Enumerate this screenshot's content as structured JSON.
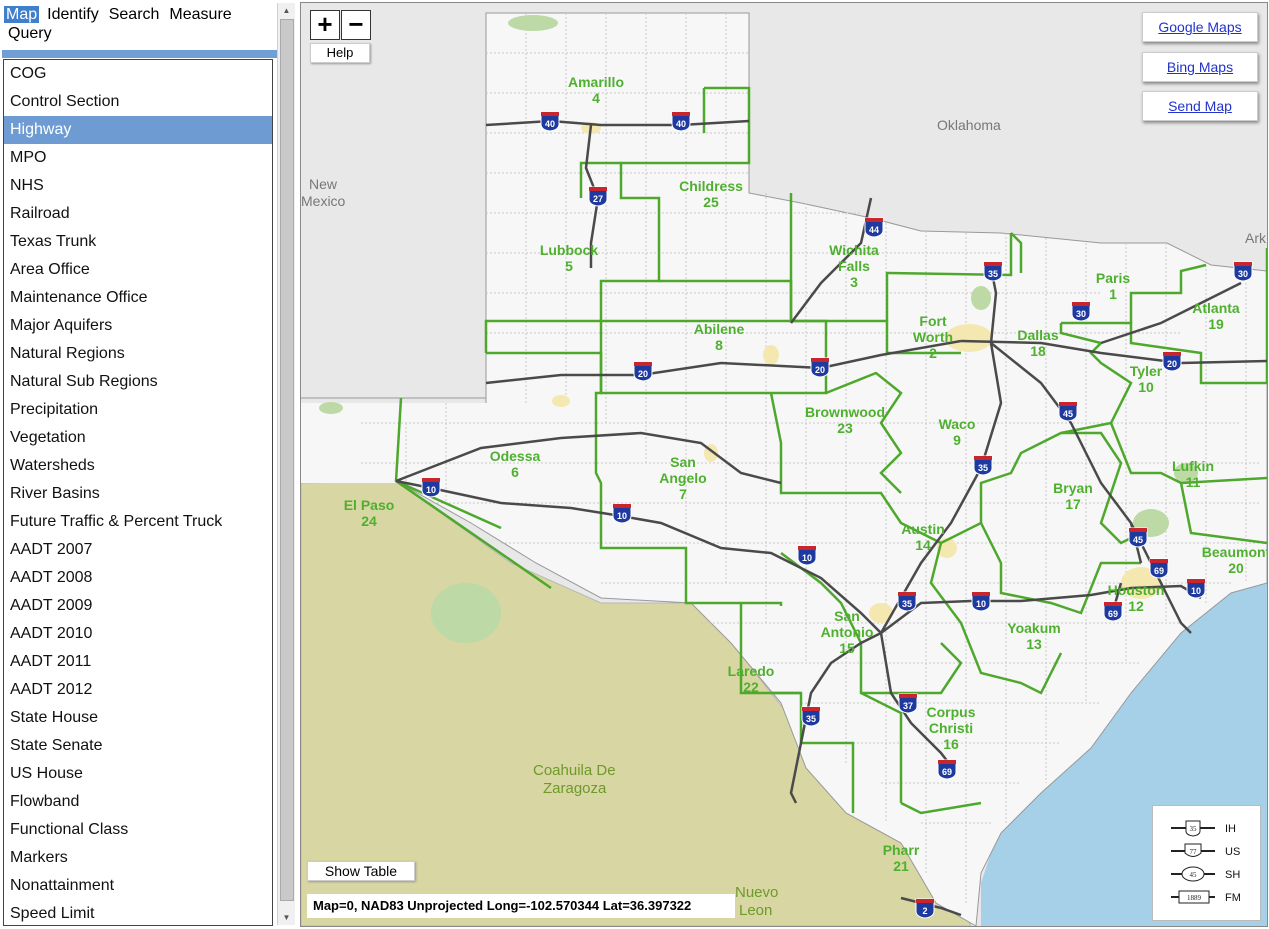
{
  "nav": {
    "tabs": [
      "Map",
      "Identify",
      "Search",
      "Measure",
      "Query"
    ],
    "selected_tab": "Map"
  },
  "layers": {
    "selected": "Highway",
    "items": [
      "COG",
      "Control Section",
      "Highway",
      "MPO",
      "NHS",
      "Railroad",
      "Texas Trunk",
      "Area Office",
      "Maintenance Office",
      "Major Aquifers",
      "Natural Regions",
      "Natural Sub Regions",
      "Precipitation",
      "Vegetation",
      "Watersheds",
      "River Basins",
      "Future Traffic & Percent Truck",
      "AADT 2007",
      "AADT 2008",
      "AADT 2009",
      "AADT 2010",
      "AADT 2011",
      "AADT 2012",
      "State House",
      "State Senate",
      "US House",
      "Flowband",
      "Functional Class",
      "Markers",
      "Nonattainment",
      "Speed Limit"
    ]
  },
  "map_controls": {
    "zoom_in": "+",
    "zoom_out": "−",
    "help": "Help",
    "google_maps": "Google Maps",
    "bing_maps": "Bing Maps",
    "send_map": "Send Map",
    "show_table": "Show Table",
    "coords_text": "Map=0, NAD83 Unprojected Long=-102.570344 Lat=36.397322"
  },
  "map": {
    "regions": {
      "oklahoma": "Oklahoma",
      "new_mexico_1": "New",
      "new_mexico_2": "Mexico",
      "arkansas": "Ark",
      "coahuila_1": "Coahuila De",
      "coahuila_2": "Zaragoza",
      "nuevo_1": "Nuevo",
      "nuevo_2": "Leon"
    },
    "districts": [
      {
        "name": [
          "Amarillo"
        ],
        "num": "4"
      },
      {
        "name": [
          "Childress"
        ],
        "num": "25"
      },
      {
        "name": [
          "Lubbock"
        ],
        "num": "5"
      },
      {
        "name": [
          "Wichita",
          "Falls"
        ],
        "num": "3"
      },
      {
        "name": [
          "Paris"
        ],
        "num": "1"
      },
      {
        "name": [
          "Atlanta"
        ],
        "num": "19"
      },
      {
        "name": [
          "Abilene"
        ],
        "num": "8"
      },
      {
        "name": [
          "Fort",
          "Worth"
        ],
        "num": "2"
      },
      {
        "name": [
          "Dallas"
        ],
        "num": "18"
      },
      {
        "name": [
          "Tyler"
        ],
        "num": "10"
      },
      {
        "name": [
          "Brownwood"
        ],
        "num": "23"
      },
      {
        "name": [
          "Waco"
        ],
        "num": "9"
      },
      {
        "name": [
          "Odessa"
        ],
        "num": "6"
      },
      {
        "name": [
          "San",
          "Angelo"
        ],
        "num": "7"
      },
      {
        "name": [
          "Lufkin"
        ],
        "num": "11"
      },
      {
        "name": [
          "El Paso"
        ],
        "num": "24"
      },
      {
        "name": [
          "Bryan"
        ],
        "num": "17"
      },
      {
        "name": [
          "Austin"
        ],
        "num": "14"
      },
      {
        "name": [
          "Beaumont"
        ],
        "num": "20"
      },
      {
        "name": [
          "Houston"
        ],
        "num": "12"
      },
      {
        "name": [
          "San",
          "Antonio"
        ],
        "num": "15"
      },
      {
        "name": [
          "Yoakum"
        ],
        "num": "13"
      },
      {
        "name": [
          "Laredo"
        ],
        "num": "22"
      },
      {
        "name": [
          "Corpus",
          "Christi"
        ],
        "num": "16"
      },
      {
        "name": [
          "Pharr"
        ],
        "num": "21"
      }
    ],
    "shields": [
      "40",
      "40",
      "27",
      "44",
      "35",
      "30",
      "30",
      "20",
      "20",
      "20",
      "45",
      "35",
      "10",
      "10",
      "10",
      "45",
      "69",
      "10",
      "35",
      "10",
      "69",
      "37",
      "35",
      "69",
      "2"
    ],
    "legend": [
      {
        "shield": "35",
        "label": "IH"
      },
      {
        "shield": "77",
        "label": "US"
      },
      {
        "shield": "45",
        "label": "SH"
      },
      {
        "shield": "1889",
        "label": "FM"
      }
    ]
  }
}
